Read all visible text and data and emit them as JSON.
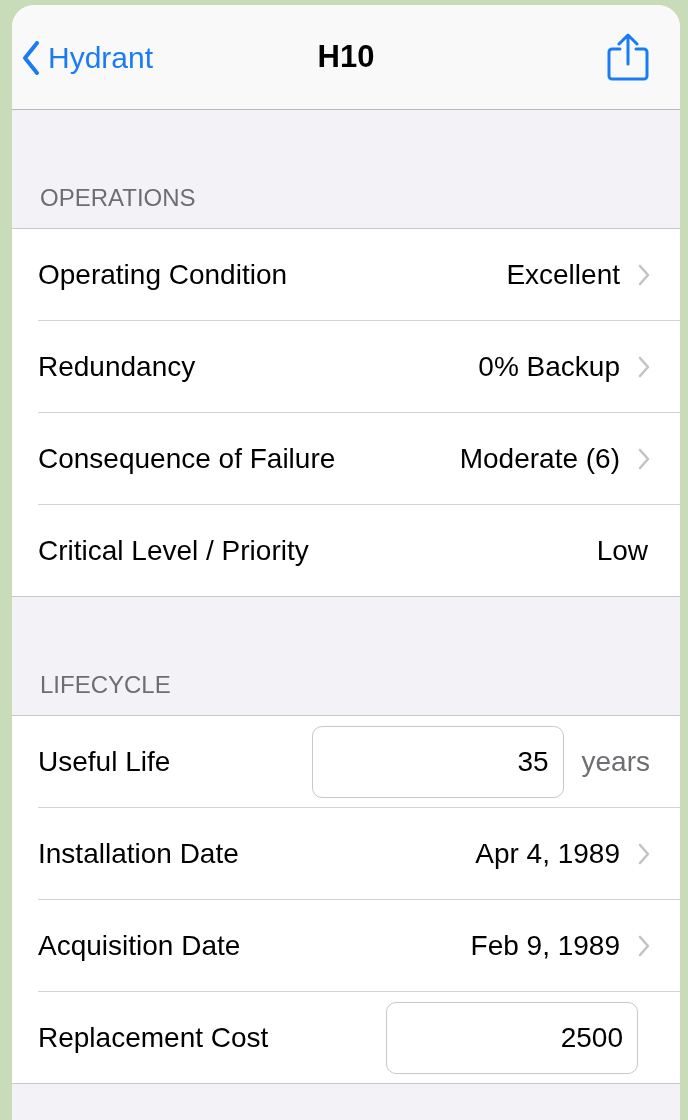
{
  "nav": {
    "back": "Hydrant",
    "title": "H10"
  },
  "sections": [
    {
      "header": "OPERATIONS",
      "rows": [
        {
          "kind": "disclosure",
          "label": "Operating Condition",
          "value": "Excellent"
        },
        {
          "kind": "disclosure",
          "label": "Redundancy",
          "value": "0% Backup"
        },
        {
          "kind": "disclosure",
          "label": "Consequence of Failure",
          "value": "Moderate (6)"
        },
        {
          "kind": "plain",
          "label": "Critical Level / Priority",
          "value": "Low"
        }
      ]
    },
    {
      "header": "LIFECYCLE",
      "rows": [
        {
          "kind": "field",
          "label": "Useful Life",
          "value": "35",
          "unit": "years"
        },
        {
          "kind": "disclosure",
          "label": "Installation Date",
          "value": "Apr 4, 1989"
        },
        {
          "kind": "disclosure",
          "label": "Acquisition Date",
          "value": "Feb 9, 1989"
        },
        {
          "kind": "field",
          "label": "Replacement Cost",
          "value": "2500"
        }
      ]
    }
  ]
}
